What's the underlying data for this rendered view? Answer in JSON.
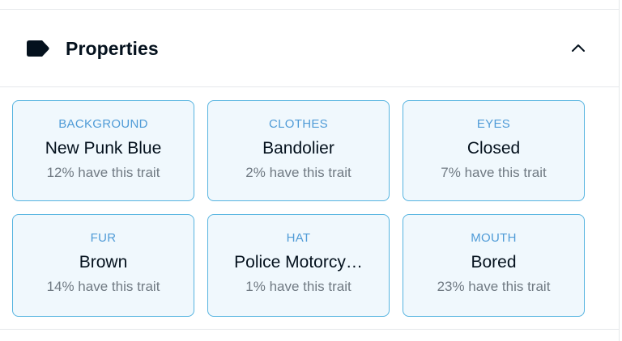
{
  "header": {
    "icon": "label-tag-icon",
    "title": "Properties",
    "toggle_icon": "chevron-up-icon"
  },
  "colors": {
    "card_border": "#56b4e0",
    "card_background": "#f0f8fd",
    "trait_type": "#4f9bd7",
    "trait_value": "#04111d",
    "trait_rarity": "#707a83"
  },
  "traits": [
    {
      "type": "BACKGROUND",
      "value": "New Punk Blue",
      "rarity": "12% have this trait"
    },
    {
      "type": "CLOTHES",
      "value": "Bandolier",
      "rarity": "2% have this trait"
    },
    {
      "type": "EYES",
      "value": "Closed",
      "rarity": "7% have this trait"
    },
    {
      "type": "FUR",
      "value": "Brown",
      "rarity": "14% have this trait"
    },
    {
      "type": "HAT",
      "value": "Police Motorcy…",
      "rarity": "1% have this trait"
    },
    {
      "type": "MOUTH",
      "value": "Bored",
      "rarity": "23% have this trait"
    }
  ]
}
